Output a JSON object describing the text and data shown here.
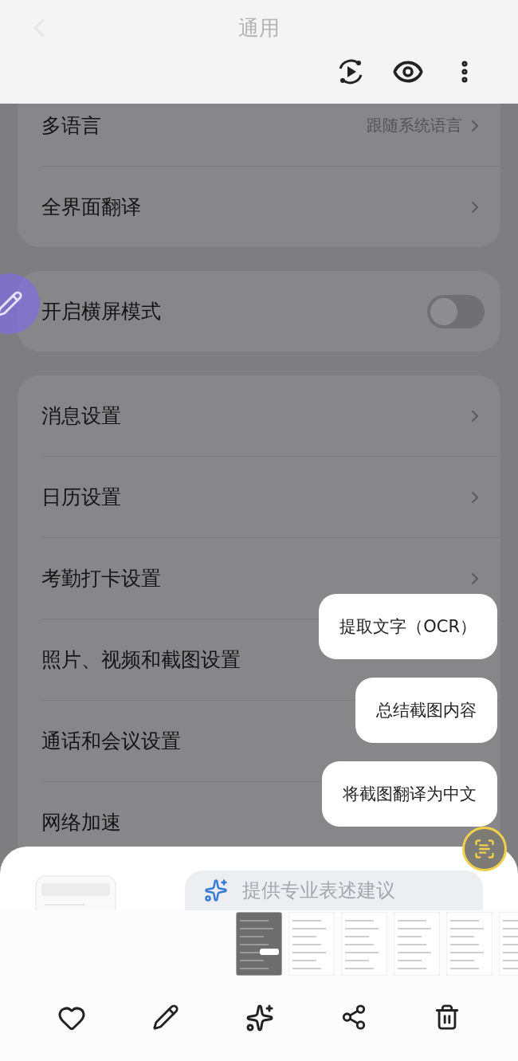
{
  "header": {
    "title": "通用"
  },
  "groups": [
    {
      "rows": [
        {
          "kind": "link",
          "label": "多语言",
          "value": "跟随系统语言"
        },
        {
          "kind": "link",
          "label": "全界面翻译"
        }
      ]
    },
    {
      "rows": [
        {
          "kind": "toggle",
          "label": "开启横屏模式",
          "on": false
        }
      ]
    },
    {
      "rows": [
        {
          "kind": "link",
          "label": "消息设置"
        },
        {
          "kind": "link",
          "label": "日历设置"
        },
        {
          "kind": "link",
          "label": "考勤打卡设置"
        },
        {
          "kind": "plain",
          "label": "照片、视频和截图设置"
        },
        {
          "kind": "plain",
          "label": "通话和会议设置"
        },
        {
          "kind": "plain",
          "label": "网络加速"
        }
      ]
    }
  ],
  "actions": [
    "提取文字（OCR）",
    "总结截图内容",
    "将截图翻译为中文"
  ],
  "suggestion": {
    "text": "提供专业表述建议"
  },
  "thumbnails": [
    {
      "selected": true
    },
    {
      "selected": false
    },
    {
      "selected": false
    },
    {
      "selected": false
    },
    {
      "selected": false
    },
    {
      "selected": false
    }
  ]
}
